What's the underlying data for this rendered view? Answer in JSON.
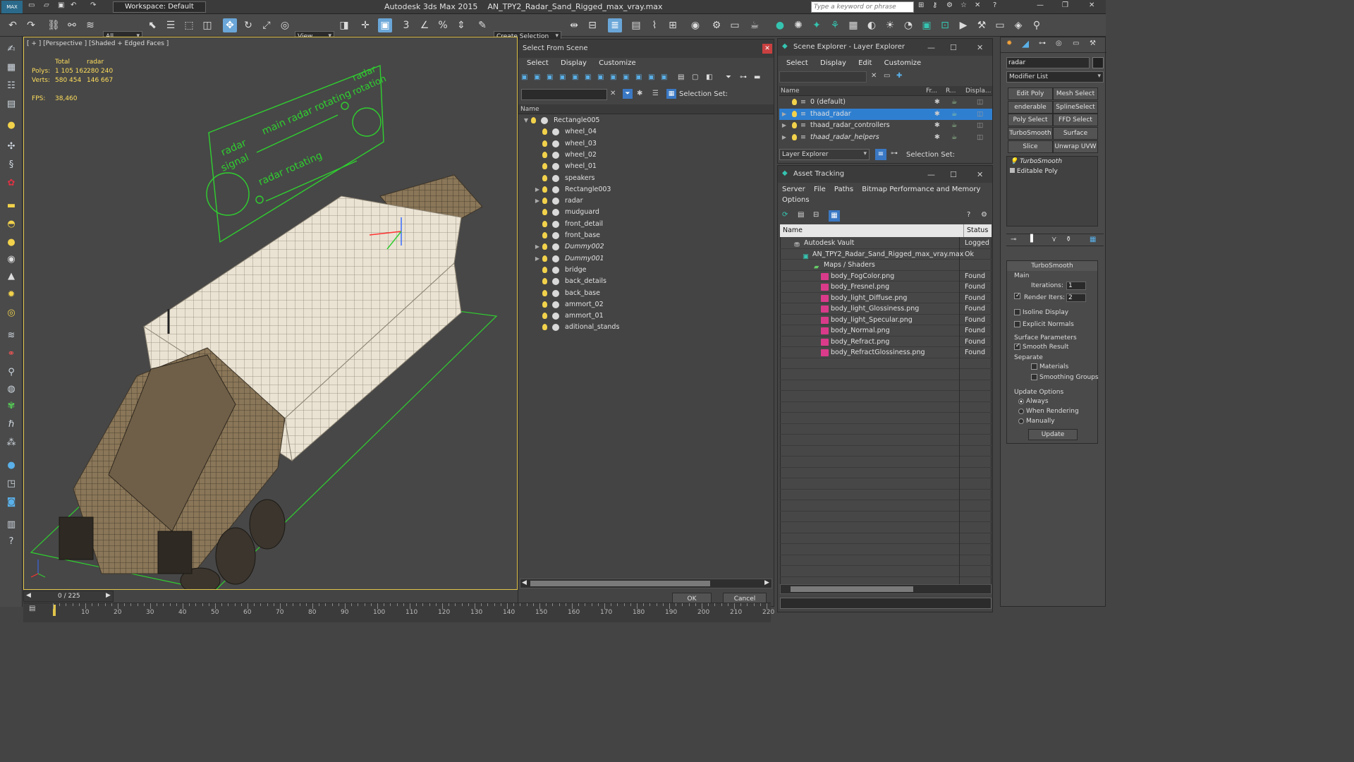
{
  "titlebar": {
    "workspace": "Workspace: Default",
    "app": "Autodesk 3ds Max  2015",
    "file": "AN_TPY2_Radar_Sand_Rigged_max_vray.max",
    "search_placeholder": "Type a keyword or phrase"
  },
  "toolbar": {
    "filter": "All",
    "coord": "View",
    "selection_set": "Create Selection Se"
  },
  "viewport": {
    "label": "[ + ] [Perspective ] [Shaded + Edged Faces ]",
    "stats": {
      "col_total": "Total",
      "col_sel": "radar",
      "polys_label": "Polys:",
      "polys_total": "1 105 162",
      "polys_sel": "280 240",
      "verts_label": "Verts:",
      "verts_total": "580 454",
      "verts_sel": "146 667",
      "fps_label": "FPS:",
      "fps": "38,460"
    }
  },
  "select_from_scene": {
    "title": "Select From Scene",
    "menu": [
      "Select",
      "Display",
      "Customize"
    ],
    "selection_set": "Selection Set:",
    "col_name": "Name",
    "items": [
      {
        "name": "Rectangle005",
        "level": 0,
        "expand": "▼",
        "italic": false
      },
      {
        "name": "wheel_04",
        "level": 1,
        "expand": "",
        "italic": false
      },
      {
        "name": "wheel_03",
        "level": 1,
        "expand": "",
        "italic": false
      },
      {
        "name": "wheel_02",
        "level": 1,
        "expand": "",
        "italic": false
      },
      {
        "name": "wheel_01",
        "level": 1,
        "expand": "",
        "italic": false
      },
      {
        "name": "speakers",
        "level": 1,
        "expand": "",
        "italic": false
      },
      {
        "name": "Rectangle003",
        "level": 1,
        "expand": "▶",
        "italic": false
      },
      {
        "name": "radar",
        "level": 1,
        "expand": "▶",
        "italic": false
      },
      {
        "name": "mudguard",
        "level": 1,
        "expand": "",
        "italic": false
      },
      {
        "name": "front_detail",
        "level": 1,
        "expand": "",
        "italic": false
      },
      {
        "name": "front_base",
        "level": 1,
        "expand": "",
        "italic": false
      },
      {
        "name": "Dummy002",
        "level": 1,
        "expand": "▶",
        "italic": true
      },
      {
        "name": "Dummy001",
        "level": 1,
        "expand": "▶",
        "italic": true
      },
      {
        "name": "bridge",
        "level": 1,
        "expand": "",
        "italic": false
      },
      {
        "name": "back_details",
        "level": 1,
        "expand": "",
        "italic": false
      },
      {
        "name": "back_base",
        "level": 1,
        "expand": "",
        "italic": false
      },
      {
        "name": "ammort_02",
        "level": 1,
        "expand": "",
        "italic": false
      },
      {
        "name": "ammort_01",
        "level": 1,
        "expand": "",
        "italic": false
      },
      {
        "name": "aditional_stands",
        "level": 1,
        "expand": "",
        "italic": false
      }
    ],
    "ok": "OK",
    "cancel": "Cancel"
  },
  "scene_explorer": {
    "title": "Scene Explorer - Layer Explorer",
    "menu": [
      "Select",
      "Display",
      "Edit",
      "Customize"
    ],
    "cols": {
      "name": "Name",
      "fr": "Fr...",
      "r": "R...",
      "disp": "Displa..."
    },
    "layers": [
      {
        "name": "0 (default)",
        "selected": false,
        "italic": false,
        "expand": ""
      },
      {
        "name": "thaad_radar",
        "selected": true,
        "italic": false,
        "expand": "▶"
      },
      {
        "name": "thaad_radar_controllers",
        "selected": false,
        "italic": false,
        "expand": "▶"
      },
      {
        "name": "thaad_radar_helpers",
        "selected": false,
        "italic": true,
        "expand": "▶"
      }
    ],
    "explorer_combo": "Layer Explorer",
    "selection_set": "Selection Set:"
  },
  "asset_tracking": {
    "title": "Asset Tracking",
    "menu": [
      "Server",
      "File",
      "Paths",
      "Bitmap Performance and Memory"
    ],
    "menu2": "Options",
    "col_name": "Name",
    "col_status": "Status",
    "rows": [
      {
        "name": "Autodesk Vault",
        "status": "Logged",
        "kind": "vault"
      },
      {
        "name": "AN_TPY2_Radar_Sand_Rigged_max_vray.max",
        "status": "Ok",
        "kind": "max"
      },
      {
        "name": "Maps / Shaders",
        "status": "",
        "kind": "folder"
      },
      {
        "name": "body_FogColor.png",
        "status": "Found",
        "kind": "png"
      },
      {
        "name": "body_Fresnel.png",
        "status": "Found",
        "kind": "png"
      },
      {
        "name": "body_light_Diffuse.png",
        "status": "Found",
        "kind": "png"
      },
      {
        "name": "body_light_Glossiness.png",
        "status": "Found",
        "kind": "png"
      },
      {
        "name": "body_light_Specular.png",
        "status": "Found",
        "kind": "png"
      },
      {
        "name": "body_Normal.png",
        "status": "Found",
        "kind": "png"
      },
      {
        "name": "body_Refract.png",
        "status": "Found",
        "kind": "png"
      },
      {
        "name": "body_RefractGlossiness.png",
        "status": "Found",
        "kind": "png"
      }
    ]
  },
  "command_panel": {
    "object_name": "radar",
    "modifier_list": "Modifier List",
    "buttons": [
      "Edit Poly",
      "Mesh Select",
      "enderable Splir",
      "SplineSelect",
      "Poly Select",
      "FFD Select",
      "TurboSmooth",
      "Surface Select",
      "Slice",
      "Unwrap UVW"
    ],
    "stack": [
      "TurboSmooth",
      "Editable Poly"
    ],
    "rollout_title": "TurboSmooth",
    "main": "Main",
    "iterations_label": "Iterations:",
    "iterations": "1",
    "render_iters_label": "Render Iters:",
    "render_iters": "2",
    "isoline": "Isoline Display",
    "explicit_normals": "Explicit Normals",
    "surface_params": "Surface Parameters",
    "smooth_result": "Smooth Result",
    "separate": "Separate",
    "materials": "Materials",
    "smoothing_groups": "Smoothing Groups",
    "update_options": "Update Options",
    "always": "Always",
    "when_rendering": "When Rendering",
    "manually": "Manually",
    "update": "Update"
  },
  "timeline": {
    "frame": "0 / 225",
    "ticks": [
      "10",
      "20",
      "30",
      "40",
      "50",
      "60",
      "70",
      "80",
      "90",
      "100",
      "110",
      "120",
      "130",
      "140",
      "150",
      "160",
      "170",
      "180",
      "190",
      "200",
      "210",
      "220"
    ]
  },
  "colors": {
    "accent": "#2f7fd0",
    "wire": "#2fd02f",
    "viewport_border": "#e1c54a"
  }
}
